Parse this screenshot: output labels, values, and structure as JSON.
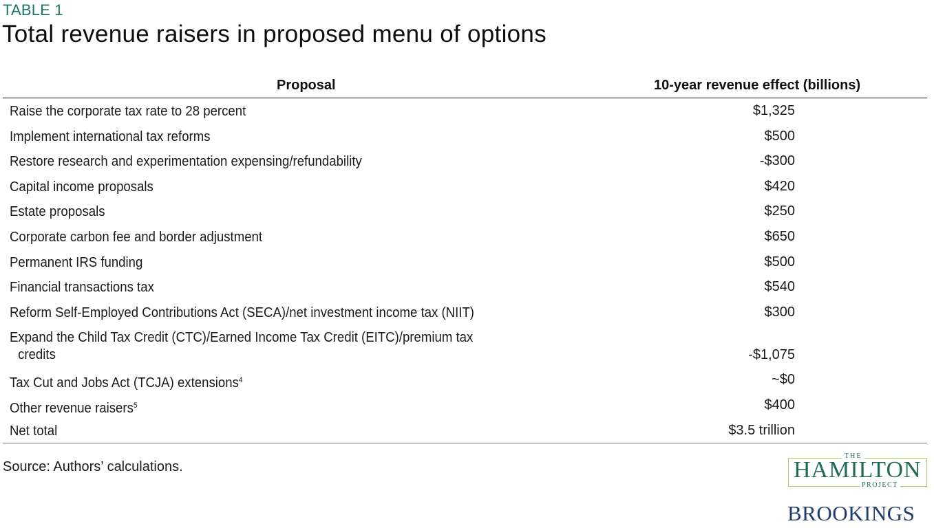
{
  "header": {
    "kicker": "TABLE 1",
    "title": "Total revenue raisers in proposed menu of options"
  },
  "table": {
    "columns": [
      "Proposal",
      "10-year revenue effect (billions)"
    ],
    "rows": [
      {
        "proposal": "Raise the corporate tax rate to 28 percent",
        "effect": "$1,325"
      },
      {
        "proposal": "Implement international tax reforms",
        "effect": "$500"
      },
      {
        "proposal": "Restore research and experimentation expensing/refundability",
        "effect": "-$300"
      },
      {
        "proposal": "Capital income proposals",
        "effect": "$420"
      },
      {
        "proposal": "Estate proposals",
        "effect": "$250"
      },
      {
        "proposal": "Corporate carbon fee and border adjustment",
        "effect": "$650"
      },
      {
        "proposal": "Permanent IRS funding",
        "effect": "$500"
      },
      {
        "proposal": "Financial transactions tax",
        "effect": "$540"
      },
      {
        "proposal": "Reform Self-Employed Contributions Act (SECA)/net investment income tax (NIIT)",
        "effect": "$300"
      },
      {
        "proposal": "Expand the Child Tax Credit (CTC)/Earned Income Tax Credit (EITC)/premium tax",
        "proposal_cont": "credits",
        "effect": "-$1,075"
      },
      {
        "proposal": "Tax Cut and Jobs Act (TCJA) extensions",
        "footnote": "4",
        "effect": "~$0"
      },
      {
        "proposal": "Other revenue raisers",
        "footnote": "5",
        "effect": "$400"
      },
      {
        "proposal": "Net total",
        "effect": "$3.5 trillion"
      }
    ]
  },
  "footer": {
    "source": "Source: Authors’ calculations.",
    "logo_hamilton_the": "THE",
    "logo_hamilton_name": "HAMILTON",
    "logo_hamilton_project": "PROJECT",
    "logo_brookings": "BROOKINGS"
  },
  "colors": {
    "kicker": "#1a7566",
    "hamilton_text": "#1f6b58",
    "hamilton_border": "#a6cf6b",
    "brookings": "#1f3c6e"
  }
}
